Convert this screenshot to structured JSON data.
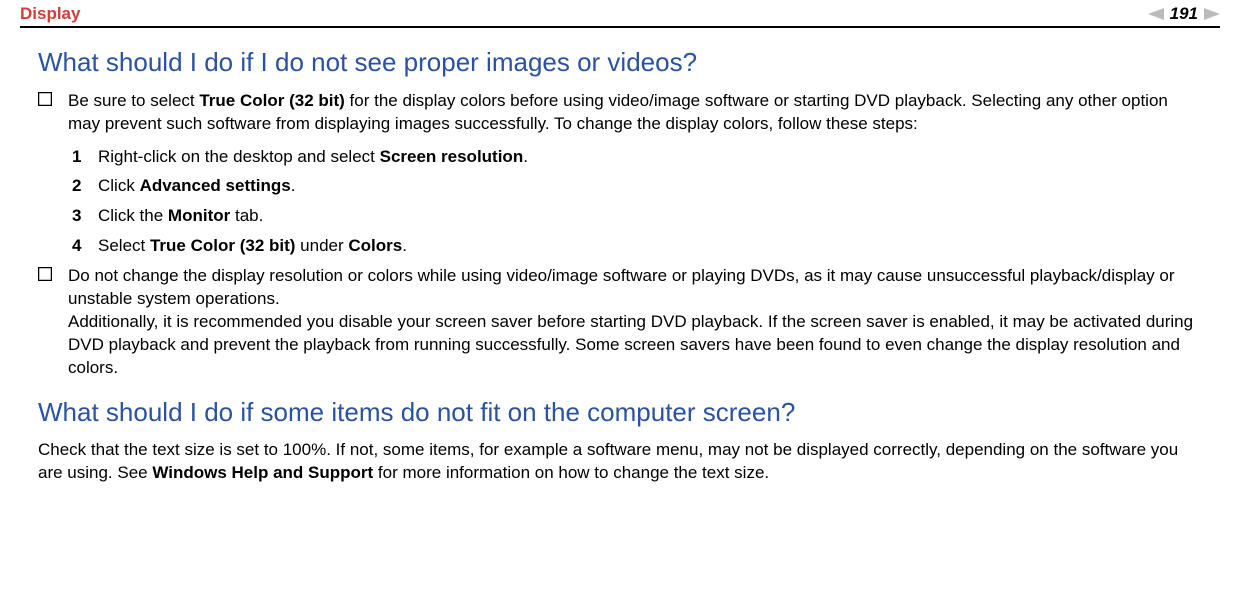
{
  "header": {
    "title": "Display",
    "page_number": "191"
  },
  "section1": {
    "heading": "What should I do if I do not see proper images or videos?",
    "bullet1_pre": "Be sure to select ",
    "bullet1_bold1": "True Color (32 bit)",
    "bullet1_post": " for the display colors before using video/image software or starting DVD playback. Selecting any other option may prevent such software from displaying images successfully. To change the display colors, follow these steps:",
    "steps": {
      "s1_pre": "Right-click on the desktop and select ",
      "s1_bold": "Screen resolution",
      "s1_post": ".",
      "s2_pre": "Click ",
      "s2_bold": "Advanced settings",
      "s2_post": ".",
      "s3_pre": "Click the ",
      "s3_bold": "Monitor",
      "s3_post": " tab.",
      "s4_pre": "Select ",
      "s4_bold1": "True Color (32 bit)",
      "s4_mid": " under ",
      "s4_bold2": "Colors",
      "s4_post": "."
    },
    "bullet2_para1": "Do not change the display resolution or colors while using video/image software or playing DVDs, as it may cause unsuccessful playback/display or unstable system operations.",
    "bullet2_para2": "Additionally, it is recommended you disable your screen saver before starting DVD playback. If the screen saver is enabled, it may be activated during DVD playback and prevent the playback from running successfully. Some screen savers have been found to even change the display resolution and colors."
  },
  "section2": {
    "heading": "What should I do if some items do not fit on the computer screen?",
    "body_pre": "Check that the text size is set to 100%. If not, some items, for example a software menu, may not be displayed correctly, depending on the software you are using. See ",
    "body_bold": "Windows Help and Support",
    "body_post": " for more information on how to change the text size."
  }
}
